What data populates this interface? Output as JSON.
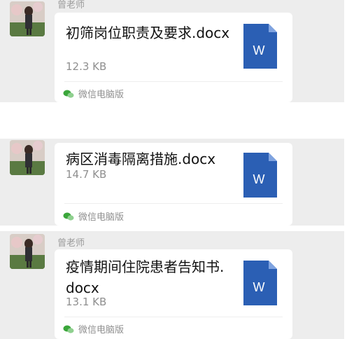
{
  "sender_name": "曾老师",
  "messages": [
    {
      "file_name": "初筛岗位职责及要求.docx",
      "file_size": "12.3 KB",
      "source_label": "微信电脑版",
      "file_icon": "word-document-icon",
      "icon_letter": "W",
      "show_sender": true
    },
    {
      "file_name": "病区消毒隔离措施.docx",
      "file_size": "14.7 KB",
      "source_label": "微信电脑版",
      "file_icon": "word-document-icon",
      "icon_letter": "W",
      "show_sender": false
    },
    {
      "file_name": "疫情期间住院患者告知书.docx",
      "file_size": "13.1 KB",
      "source_label": "微信电脑版",
      "file_icon": "word-document-icon",
      "icon_letter": "W",
      "show_sender": true
    }
  ],
  "colors": {
    "chat_background": "#ededed",
    "bubble_background": "#ffffff",
    "word_icon_blue": "#2b5fb4",
    "wechat_green": "#3aa63a"
  }
}
